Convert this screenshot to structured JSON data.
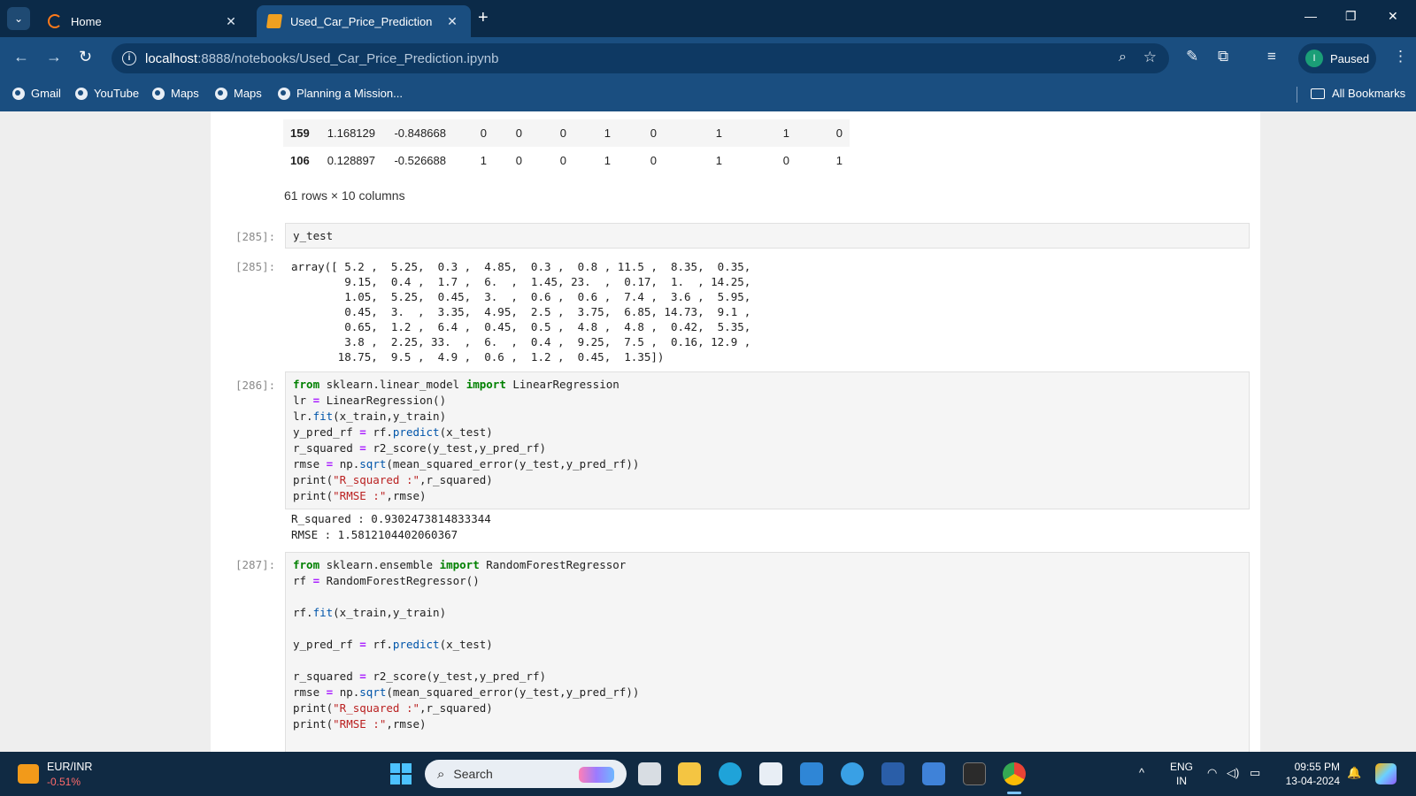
{
  "browser": {
    "tabs": [
      {
        "title": "Home",
        "icon": "spinner-icon"
      },
      {
        "title": "Used_Car_Price_Prediction",
        "icon": "notebook-icon"
      }
    ],
    "new_tab": "+",
    "url_host": "localhost",
    "url_rest": ":8888/notebooks/Used_Car_Price_Prediction.ipynb",
    "profile_initial": "I",
    "profile_status": "Paused",
    "bookmarks": [
      "Gmail",
      "YouTube",
      "Maps",
      "Maps",
      "Planning a Mission..."
    ],
    "all_bookmarks": "All Bookmarks"
  },
  "notebook": {
    "df_rows": [
      {
        "idx": "159",
        "cells": [
          "1.168129",
          "-0.848668",
          "0",
          "0",
          "0",
          "1",
          "0",
          "1",
          "1",
          "0"
        ]
      },
      {
        "idx": "106",
        "cells": [
          "0.128897",
          "-0.526688",
          "1",
          "0",
          "0",
          "1",
          "0",
          "1",
          "0",
          "1"
        ]
      }
    ],
    "df_shape": "61 rows × 10 columns",
    "cells": [
      {
        "prompt": "[285]:",
        "code": "y_test"
      },
      {
        "prompt": "[285]:",
        "output": "array([ 5.2 ,  5.25,  0.3 ,  4.85,  0.3 ,  0.8 , 11.5 ,  8.35,  0.35,\n        9.15,  0.4 ,  1.7 ,  6.  ,  1.45, 23.  ,  0.17,  1.  , 14.25,\n        1.05,  5.25,  0.45,  3.  ,  0.6 ,  0.6 ,  7.4 ,  3.6 ,  5.95,\n        0.45,  3.  ,  3.35,  4.95,  2.5 ,  3.75,  6.85, 14.73,  9.1 ,\n        0.65,  1.2 ,  6.4 ,  0.45,  0.5 ,  4.8 ,  4.8 ,  0.42,  5.35,\n        3.8 ,  2.25, 33.  ,  6.  ,  0.4 ,  9.25,  7.5 ,  0.16, 12.9 ,\n       18.75,  9.5 ,  4.9 ,  0.6 ,  1.2 ,  0.45,  1.35])"
      },
      {
        "prompt": "[286]:",
        "code": "from sklearn.linear_model import LinearRegression\nlr = LinearRegression()\nlr.fit(x_train,y_train)\ny_pred_rf = rf.predict(x_test)\nr_squared = r2_score(y_test,y_pred_rf)\nrmse = np.sqrt(mean_squared_error(y_test,y_pred_rf))\nprint(\"R_squared :\",r_squared)\nprint(\"RMSE :\",rmse)"
      },
      {
        "output": "R_squared : 0.9302473814833344\nRMSE : 1.5812104402060367"
      },
      {
        "prompt": "[287]:",
        "code": "from sklearn.ensemble import RandomForestRegressor\nrf = RandomForestRegressor()\n\nrf.fit(x_train,y_train)\n\ny_pred_rf = rf.predict(x_test)\n\nr_squared = r2_score(y_test,y_pred_rf)\nrmse = np.sqrt(mean_squared_error(y_test,y_pred_rf))\nprint(\"R_squared :\",r_squared)\nprint(\"RMSE :\",rmse)"
      }
    ]
  },
  "taskbar": {
    "forex_pair": "EUR/INR",
    "forex_change": "-0.51%",
    "search_label": "Search",
    "lang_1": "ENG",
    "lang_2": "IN",
    "time": "09:55 PM",
    "date": "13-04-2024",
    "colors": {
      "accent": "#4cc2ff",
      "negative": "#ff6b6b"
    }
  }
}
